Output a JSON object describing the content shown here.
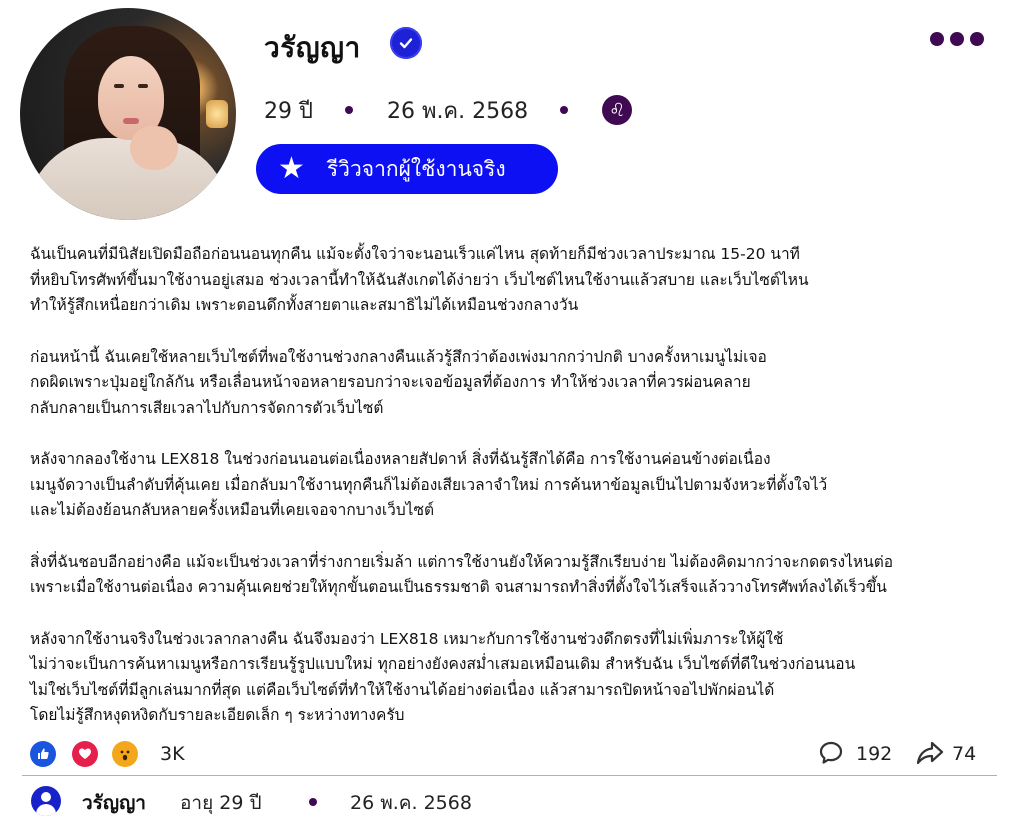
{
  "profile": {
    "name": "วรัญญา",
    "age": "29 ปี",
    "date": "26 พ.ค. 2568",
    "zodiac_symbol": "♌",
    "review_badge": "รีวิวจากผู้ใช้งานจริง"
  },
  "colors": {
    "accent_blue": "#0c10f2",
    "dark_purple": "#3f0a52",
    "like": "#1a55e0",
    "love": "#e5204a",
    "wow": "#f4a71b"
  },
  "post": {
    "paragraphs": [
      [
        "ฉันเป็นคนที่มีนิสัยเปิดมือถือก่อนนอนทุกคืน แม้จะตั้งใจว่าจะนอนเร็วแค่ไหน สุดท้ายก็มีช่วงเวลาประมาณ 15-20 นาที",
        "ที่หยิบโทรศัพท์ขึ้นมาใช้งานอยู่เสมอ ช่วงเวลานี้ทำให้ฉันสังเกตได้ง่ายว่า เว็บไซต์ไหนใช้งานแล้วสบาย และเว็บไซต์ไหน",
        "ทำให้รู้สึกเหนื่อยกว่าเดิม เพราะตอนดึกทั้งสายตาและสมาธิไม่ได้เหมือนช่วงกลางวัน"
      ],
      [
        "ก่อนหน้านี้ ฉันเคยใช้หลายเว็บไซต์ที่พอใช้งานช่วงกลางคืนแล้วรู้สึกว่าต้องเพ่งมากกว่าปกติ บางครั้งหาเมนูไม่เจอ",
        "กดผิดเพราะปุ่มอยู่ใกล้กัน หรือเลื่อนหน้าจอหลายรอบกว่าจะเจอข้อมูลที่ต้องการ ทำให้ช่วงเวลาที่ควรผ่อนคลาย",
        "กลับกลายเป็นการเสียเวลาไปกับการจัดการตัวเว็บไซต์"
      ],
      [
        "หลังจากลองใช้งาน LEX818 ในช่วงก่อนนอนต่อเนื่องหลายสัปดาห์ สิ่งที่ฉันรู้สึกได้คือ การใช้งานค่อนข้างต่อเนื่อง",
        "เมนูจัดวางเป็นลำดับที่คุ้นเคย เมื่อกลับมาใช้งานทุกคืนก็ไม่ต้องเสียเวลาจำใหม่ การค้นหาข้อมูลเป็นไปตามจังหวะที่ตั้งใจไว้",
        "และไม่ต้องย้อนกลับหลายครั้งเหมือนที่เคยเจอจากบางเว็บไซต์"
      ],
      [
        "สิ่งที่ฉันชอบอีกอย่างคือ แม้จะเป็นช่วงเวลาที่ร่างกายเริ่มล้า แต่การใช้งานยังให้ความรู้สึกเรียบง่าย ไม่ต้องคิดมากว่าจะกดตรงไหนต่อ",
        "เพราะเมื่อใช้งานต่อเนื่อง ความคุ้นเคยช่วยให้ทุกขั้นตอนเป็นธรรมชาติ จนสามารถทำสิ่งที่ตั้งใจไว้เสร็จแล้ววางโทรศัพท์ลงได้เร็วขึ้น"
      ],
      [
        "หลังจากใช้งานจริงในช่วงเวลากลางคืน ฉันจึงมองว่า LEX818 เหมาะกับการใช้งานช่วงดึกตรงที่ไม่เพิ่มภาระให้ผู้ใช้",
        "ไม่ว่าจะเป็นการค้นหาเมนูหรือการเรียนรู้รูปแบบใหม่ ทุกอย่างยังคงสม่ำเสมอเหมือนเดิม สำหรับฉัน เว็บไซต์ที่ดีในช่วงก่อนนอน",
        "ไม่ใช่เว็บไซต์ที่มีลูกเล่นมากที่สุด แต่คือเว็บไซต์ที่ทำให้ใช้งานได้อย่างต่อเนื่อง แล้วสามารถปิดหน้าจอไปพักผ่อนได้",
        "โดยไม่รู้สึกหงุดหงิดกับรายละเอียดเล็ก ๆ ระหว่างทางครับ"
      ]
    ]
  },
  "stats": {
    "reactions_count": "3K",
    "comments_count": "192",
    "shares_count": "74"
  },
  "footer": {
    "name": "วรัญญา",
    "age": "อายุ 29 ปี",
    "date": "26 พ.ค. 2568"
  }
}
